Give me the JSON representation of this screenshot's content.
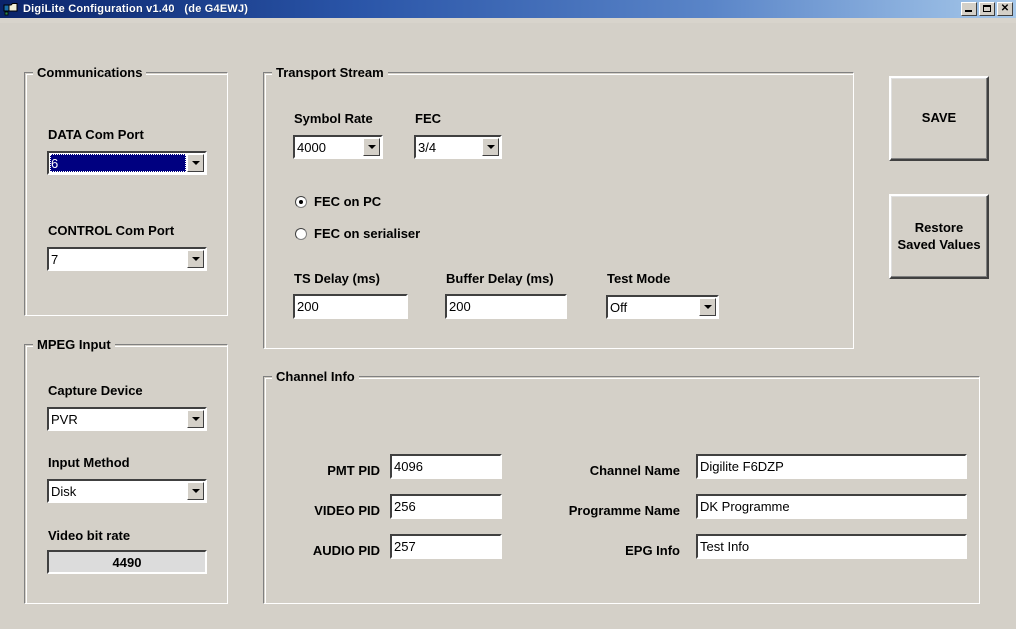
{
  "window": {
    "title": "DigiLite Configuration v1.40   (de G4EWJ)",
    "icon": "form-window-icon",
    "minimize_label": "",
    "maximize_label": "",
    "close_label": "✕"
  },
  "communications": {
    "group_title": "Communications",
    "data_com_port": {
      "label": "DATA Com Port",
      "value": "6"
    },
    "control_com_port": {
      "label": "CONTROL Com Port",
      "value": "7"
    }
  },
  "mpeg_input": {
    "group_title": "MPEG Input",
    "capture_device": {
      "label": "Capture Device",
      "value": "PVR"
    },
    "input_method": {
      "label": "Input Method",
      "value": "Disk"
    },
    "video_bit_rate": {
      "label": "Video bit rate",
      "value": "4490"
    }
  },
  "transport_stream": {
    "group_title": "Transport Stream",
    "symbol_rate": {
      "label": "Symbol Rate",
      "value": "4000"
    },
    "fec": {
      "label": "FEC",
      "value": "3/4"
    },
    "fec_mode": {
      "options": [
        {
          "label": "FEC on PC",
          "selected": true
        },
        {
          "label": "FEC on serialiser",
          "selected": false
        }
      ]
    },
    "ts_delay": {
      "label": "TS Delay (ms)",
      "value": "200"
    },
    "buffer_delay": {
      "label": "Buffer Delay (ms)",
      "value": "200"
    },
    "test_mode": {
      "label": "Test Mode",
      "value": "Off"
    }
  },
  "channel_info": {
    "group_title": "Channel Info",
    "pmt_pid": {
      "label": "PMT PID",
      "value": "4096"
    },
    "video_pid": {
      "label": "VIDEO PID",
      "value": "256"
    },
    "audio_pid": {
      "label": "AUDIO PID",
      "value": "257"
    },
    "channel_name": {
      "label": "Channel Name",
      "value": "Digilite F6DZP"
    },
    "programme_name": {
      "label": "Programme Name",
      "value": "DK Programme"
    },
    "epg_info": {
      "label": "EPG Info",
      "value": "Test Info"
    }
  },
  "actions": {
    "save_label": "SAVE",
    "restore_label": "Restore\nSaved Values"
  },
  "colors": {
    "face": "#d4d0c8",
    "title_start": "#0a246a",
    "title_end": "#a6c8ea",
    "selection": "#000080",
    "field_bg": "#ffffff",
    "readonly_bg": "#dcdcdc"
  }
}
